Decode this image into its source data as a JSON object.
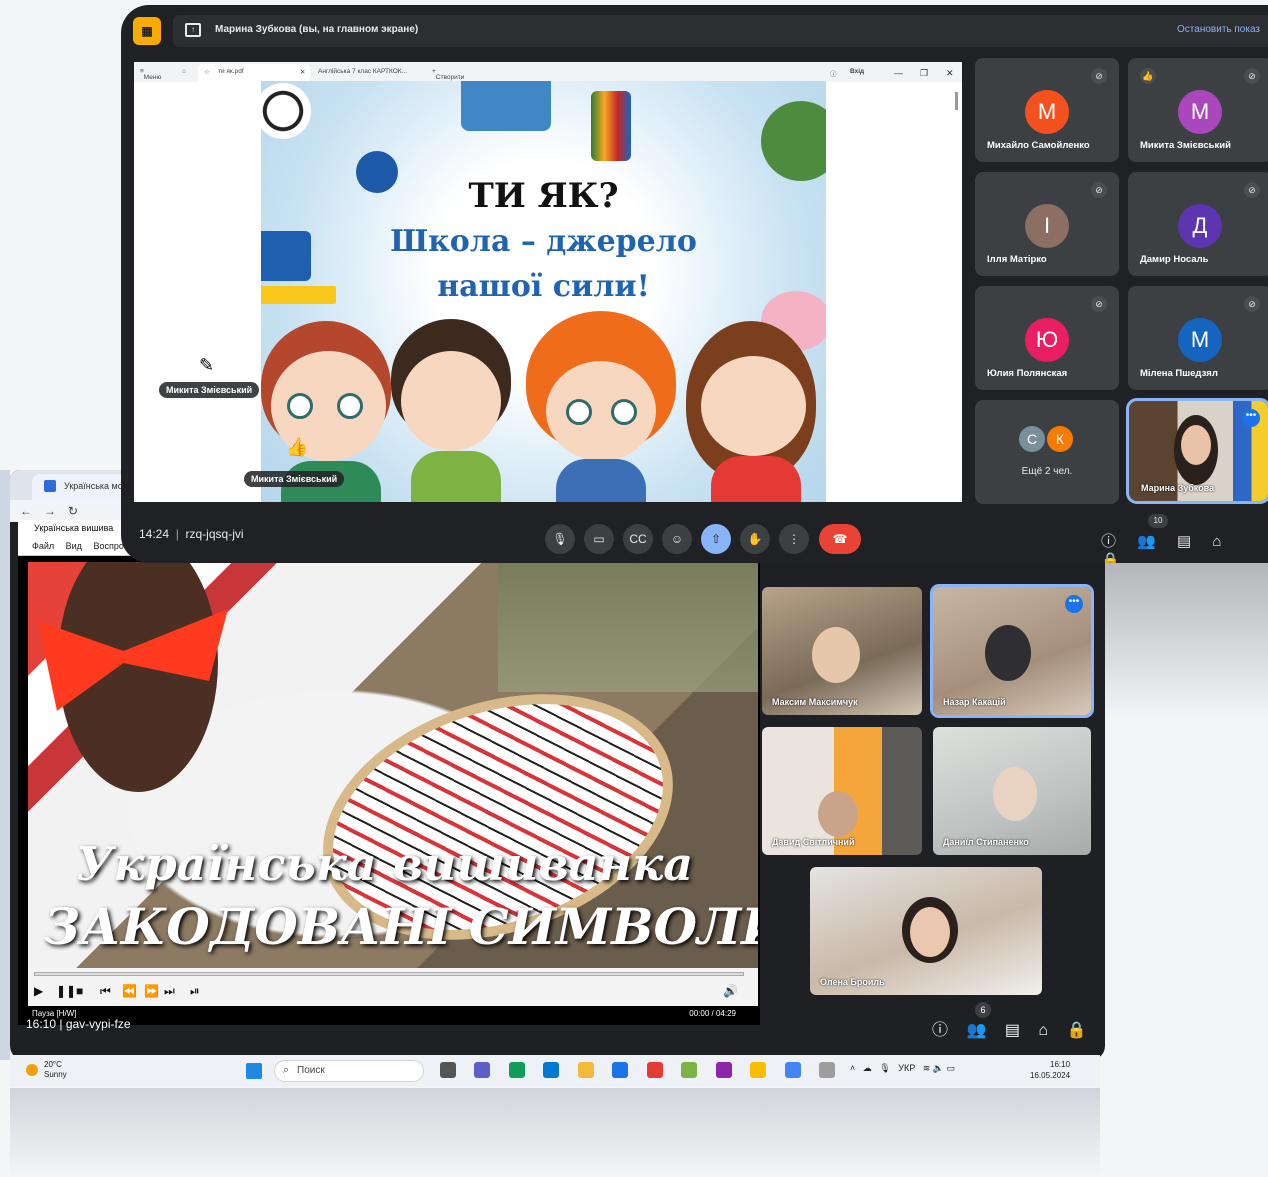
{
  "back_window": {
    "tab_label": "Українська мов",
    "player_title": "Українська вишива",
    "player_menu": [
      "Файл",
      "Вид",
      "Воспроизв"
    ],
    "video_title_line1": "Українська вишиванка",
    "video_title_line2": "ЗАКОДОВАНІ СИМВОЛИ",
    "status_left": "Пауза [H/W]",
    "status_right": "00:00 / 04:29",
    "meeting_code": "16:10 | gav-vypi-fze",
    "participants_badge": "6",
    "tiles": [
      {
        "name": "Максим Максимчук"
      },
      {
        "name": "Назар Какацій"
      },
      {
        "name": "Давид Світличний"
      },
      {
        "name": "Даниїл Стипаненко"
      },
      {
        "name": "Олена Броиль"
      }
    ]
  },
  "taskbar": {
    "weather_temp": "20°C",
    "weather_desc": "Sunny",
    "search_placeholder": "Поиск",
    "language": "УКР",
    "time": "16:10",
    "date": "16.05.2024"
  },
  "meet": {
    "presenting_text": "Марина Зубкова (вы, на главном экране)",
    "stop_sharing": "Остановить показ",
    "browser": {
      "menu_label": "Меню",
      "tab1": "ти як.pdf",
      "tab2": "Англійська 7 клас КАРТКОК...",
      "new_tab": "Створити",
      "sign_in": "Вхід"
    },
    "slide": {
      "line1": "ТИ ЯК?",
      "line2": "Школа – джерело",
      "line3": "нашої сили!"
    },
    "pointer_labels": [
      "Микита Змієвський",
      "Микита Змієвський"
    ],
    "participants": [
      {
        "initial": "М",
        "name": "Михайло Самойленко",
        "color": "#f4511e"
      },
      {
        "initial": "М",
        "name": "Микита Змієвський",
        "color": "#ab47bc"
      },
      {
        "initial": "І",
        "name": "Ілля Матірко",
        "color": "#8d6e63"
      },
      {
        "initial": "Д",
        "name": "Дамир Носаль",
        "color": "#5e35b1"
      },
      {
        "initial": "Ю",
        "name": "Юлия Полянская",
        "color": "#e91e63"
      },
      {
        "initial": "М",
        "name": "Мілена Пшедзял",
        "color": "#1565c0"
      }
    ],
    "more": {
      "initials": [
        "С",
        "К"
      ],
      "label": "Ещё 2 чел."
    },
    "self_name": "Марина Зубкова",
    "time_code": "14:24",
    "meeting_code": "rzq-jqsq-jvi",
    "participants_badge": "10"
  },
  "colors": {
    "meet_bg": "#202124",
    "accent_blue": "#8ab4f8",
    "end_call": "#ea4335",
    "present_badge": "#f9ab00"
  }
}
